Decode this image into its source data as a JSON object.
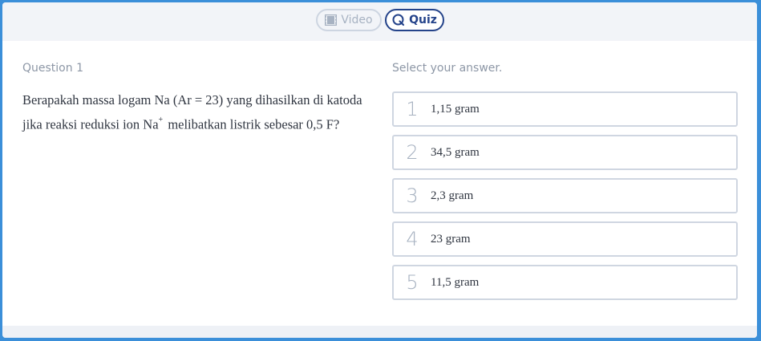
{
  "tabs": {
    "video_label": "Video",
    "quiz_label": "Quiz"
  },
  "question": {
    "number_label": "Question 1",
    "text_part1": "Berapakah massa logam Na (Ar = 23) yang dihasilkan di katoda jika reaksi reduksi ion Na",
    "superscript": "+",
    "text_part2": " melibatkan listrik sebesar 0,5 F?"
  },
  "answers": {
    "prompt": "Select your answer.",
    "options": [
      {
        "num": "1",
        "text": "1,15 gram"
      },
      {
        "num": "2",
        "text": "34,5 gram"
      },
      {
        "num": "3",
        "text": "2,3 gram"
      },
      {
        "num": "4",
        "text": "23 gram"
      },
      {
        "num": "5",
        "text": "11,5 gram"
      }
    ]
  },
  "colors": {
    "outer_border": "#3b8fd9",
    "quiz_accent": "#24438a",
    "option_border": "#cfd6e1"
  }
}
